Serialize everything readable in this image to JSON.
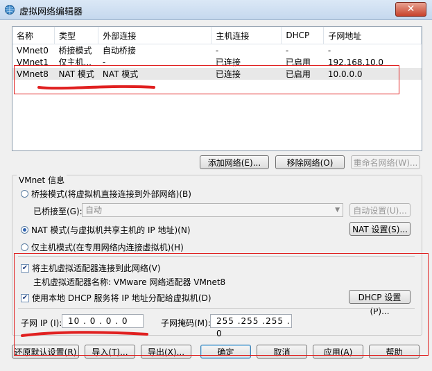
{
  "window": {
    "title": "虚拟网络编辑器",
    "close_label": "✕"
  },
  "network_table": {
    "columns": [
      "名称",
      "类型",
      "外部连接",
      "主机连接",
      "DHCP",
      "子网地址"
    ],
    "rows": [
      [
        "VMnet0",
        "桥接模式",
        "自动桥接",
        "-",
        "-",
        "-"
      ],
      [
        "VMnet1",
        "仅主机...",
        "-",
        "已连接",
        "已启用",
        "192.168.10.0"
      ],
      [
        "VMnet8",
        "NAT 模式",
        "NAT 模式",
        "已连接",
        "已启用",
        "10.0.0.0"
      ]
    ],
    "selected_row": 2
  },
  "table_buttons": {
    "add": "添加网络(E)...",
    "remove": "移除网络(O)",
    "rename": "重命名网络(W)..."
  },
  "vmnet_info": {
    "title": "VMnet 信息",
    "bridged_radio": "桥接模式(将虚拟机直接连接到外部网络)(B)",
    "bridged_to_label": "已桥接至(G):",
    "bridged_to_value": "自动",
    "auto_settings": "自动设置(U)...",
    "nat_radio": "NAT 模式(与虚拟机共享主机的 IP 地址)(N)",
    "nat_settings": "NAT 设置(S)...",
    "hostonly_radio": "仅主机模式(在专用网络内连接虚拟机)(H)",
    "selected_mode": "nat",
    "connect_adapter_check": "将主机虚拟适配器连接到此网络(V)",
    "connect_adapter_checked": true,
    "adapter_name": "主机虚拟适配器名称: VMware 网络适配器 VMnet8",
    "dhcp_check": "使用本地 DHCP 服务将 IP 地址分配给虚拟机(D)",
    "dhcp_checked": true,
    "dhcp_settings": "DHCP 设置(P)...",
    "subnet_ip_label": "子网 IP (I):",
    "subnet_ip_value": "10 . 0 . 0 . 0",
    "subnet_mask_label": "子网掩码(M):",
    "subnet_mask_value": "255 .255 .255 . 0"
  },
  "bottom_buttons": {
    "restore": "还原默认设置(R)",
    "import": "导入(T)...",
    "export": "导出(X)...",
    "ok": "确定",
    "cancel": "取消",
    "apply": "应用(A)",
    "help": "帮助"
  },
  "colors": {
    "annotation_red": "#e02020",
    "titlebar": "#c5d8ee",
    "close_button": "#c7422b"
  }
}
